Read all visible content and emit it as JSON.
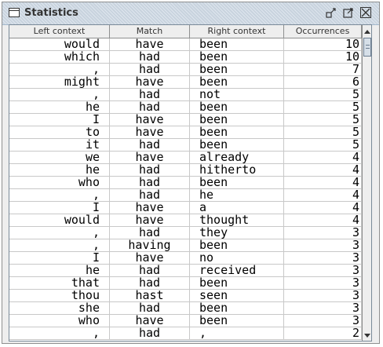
{
  "window": {
    "title": "Statistics",
    "title_icon": "window-icon"
  },
  "titlebar_buttons": {
    "minimize": "minimize-icon",
    "maximize": "maximize-icon",
    "close": "close-icon"
  },
  "table": {
    "columns": [
      "Left context",
      "Match",
      "Right context",
      "Occurrences"
    ],
    "rows": [
      [
        "would",
        "have",
        "been",
        "10"
      ],
      [
        "which",
        "had",
        "been",
        "10"
      ],
      [
        ",",
        "had",
        "been",
        "7"
      ],
      [
        "might",
        "have",
        "been",
        "6"
      ],
      [
        ",",
        "had",
        "not",
        "5"
      ],
      [
        "he",
        "had",
        "been",
        "5"
      ],
      [
        "I",
        "have",
        "been",
        "5"
      ],
      [
        "to",
        "have",
        "been",
        "5"
      ],
      [
        "it",
        "had",
        "been",
        "5"
      ],
      [
        "we",
        "have",
        "already",
        "4"
      ],
      [
        "he",
        "had",
        "hitherto",
        "4"
      ],
      [
        "who",
        "had",
        "been",
        "4"
      ],
      [
        ",",
        "had",
        "he",
        "4"
      ],
      [
        "I",
        "have",
        "a",
        "4"
      ],
      [
        "would",
        "have",
        "thought",
        "4"
      ],
      [
        ",",
        "had",
        "they",
        "3"
      ],
      [
        ",",
        "having",
        "been",
        "3"
      ],
      [
        "I",
        "have",
        "no",
        "3"
      ],
      [
        "he",
        "had",
        "received",
        "3"
      ],
      [
        "that",
        "had",
        "been",
        "3"
      ],
      [
        "thou",
        "hast",
        "seen",
        "3"
      ],
      [
        "she",
        "had",
        "been",
        "3"
      ],
      [
        "who",
        "have",
        "been",
        "3"
      ],
      [
        ",",
        "had",
        ",",
        "2"
      ]
    ]
  },
  "scrollbar": {
    "up": "arrow-up-icon",
    "down": "arrow-down-icon"
  }
}
